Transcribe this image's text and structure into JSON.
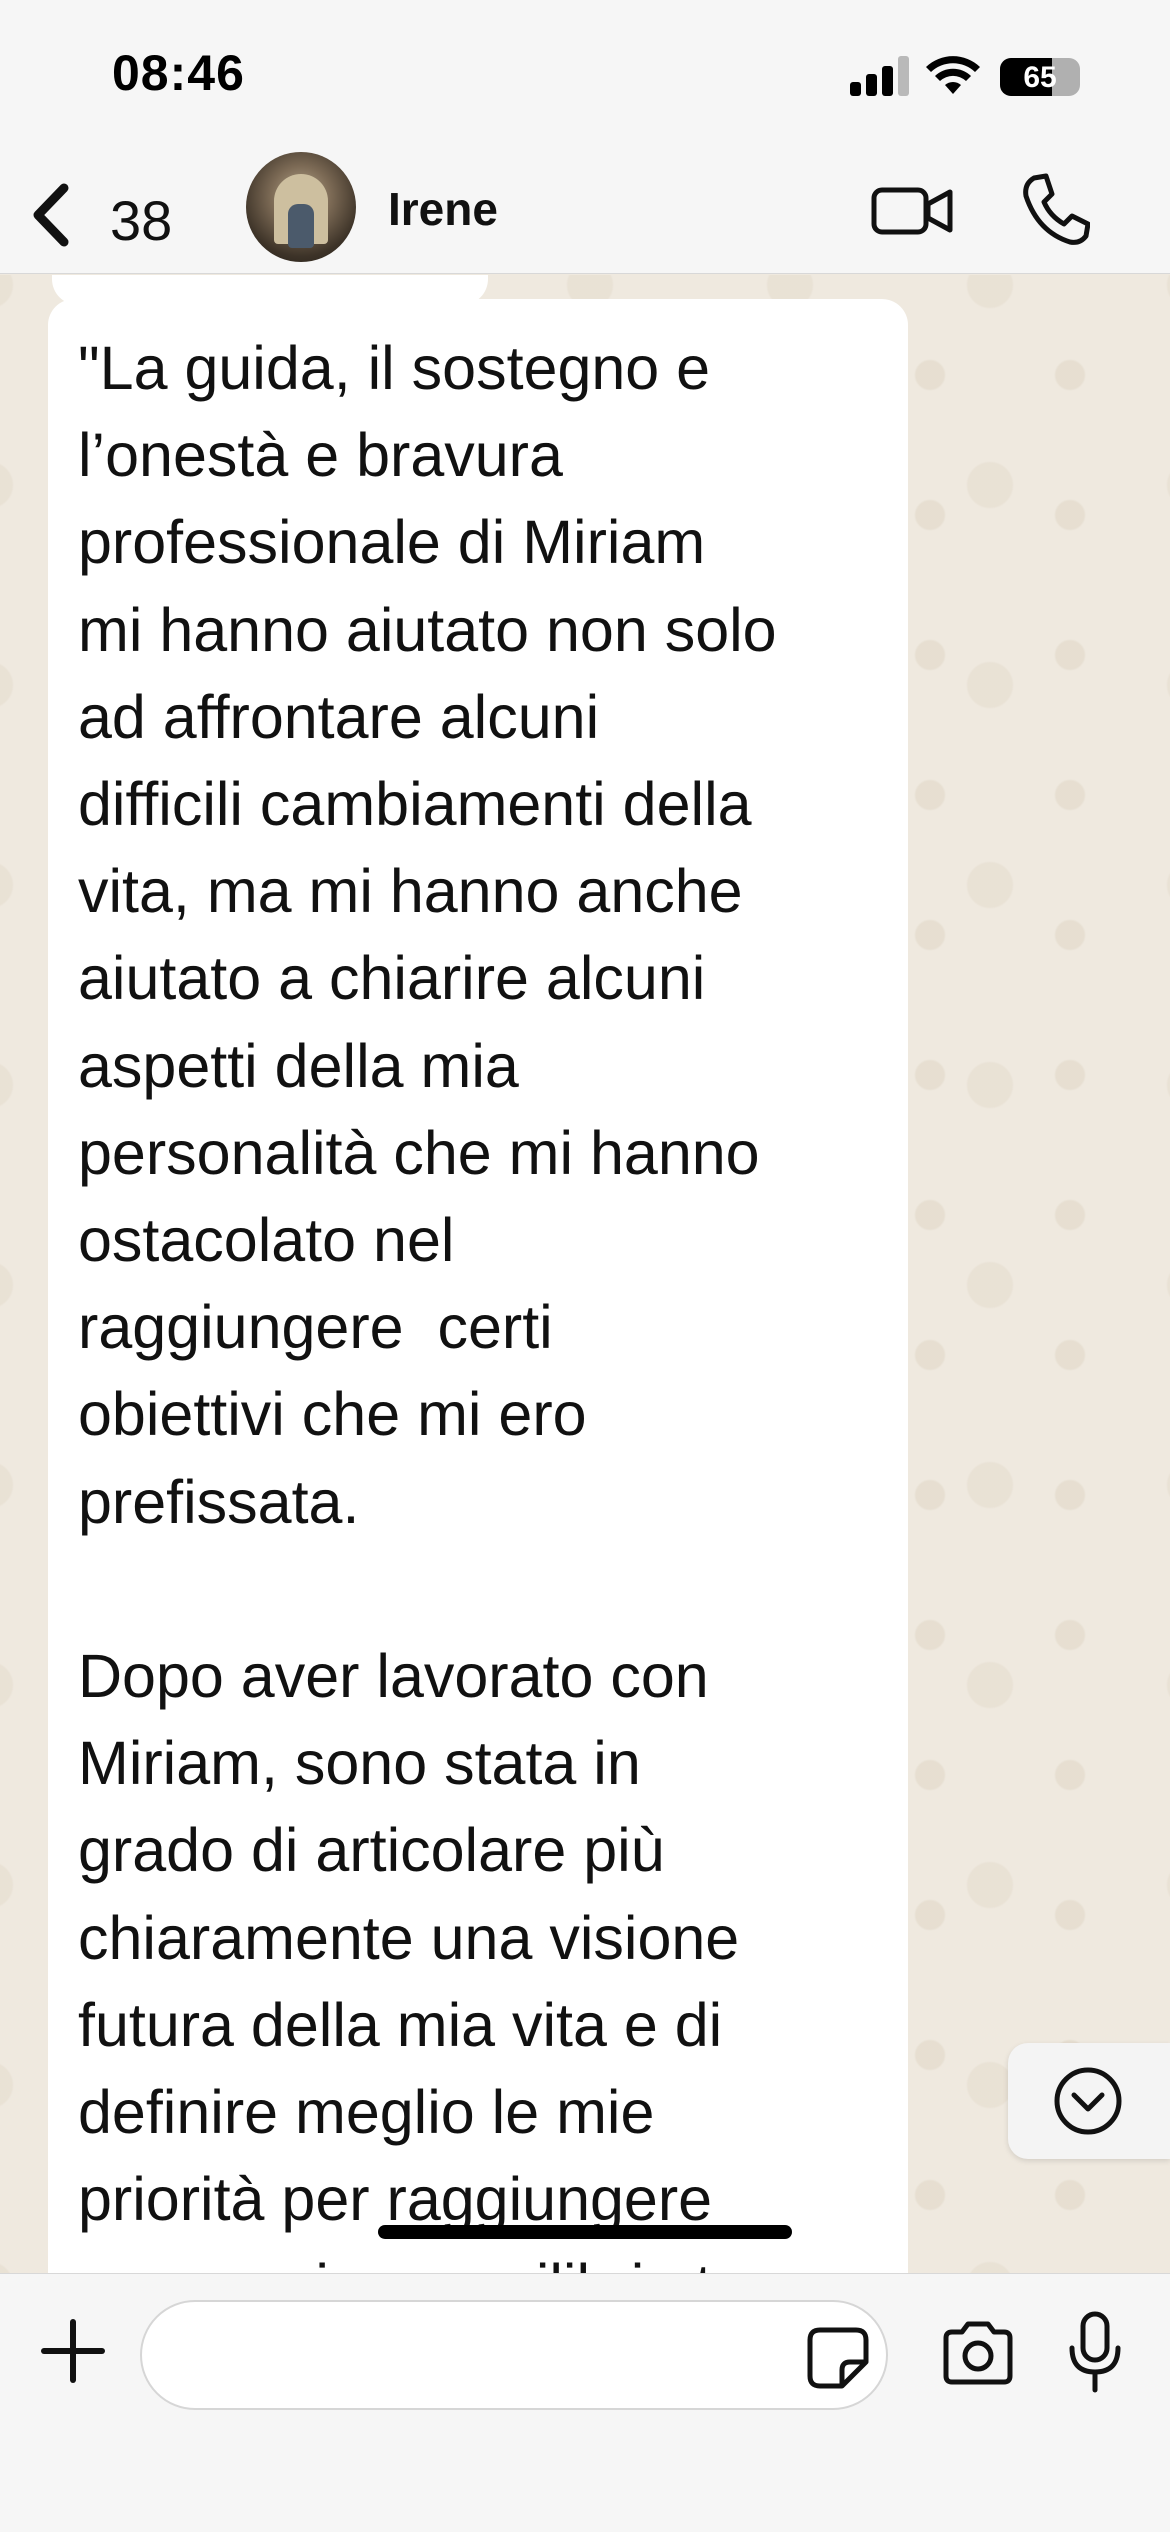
{
  "status_bar": {
    "time": "08:46",
    "battery_level": "65",
    "battery_percent": 65,
    "signal_bars": 3,
    "signal_bars_total": 4,
    "icons": [
      "cellular-signal-icon",
      "wifi-icon",
      "battery-icon"
    ]
  },
  "header": {
    "back_icon": "chevron-left-icon",
    "unread_count": "38",
    "contact_name": "Irene",
    "actions": [
      "video-camera-icon",
      "phone-icon"
    ]
  },
  "message": {
    "text": "\"La guida, il sostegno e\nl’onestà e bravura\nprofessionale di Miriam\nmi hanno aiutato non solo\nad affrontare alcuni\ndifficili cambiamenti della\nvita, ma mi hanno anche\naiutato a chiarire alcuni\naspetti della mia\npersonalità che mi hanno\nostacolato nel\nraggiungere  certi\nobiettivi che mi ero\nprefissata.\n\nDopo aver lavorato con\nMiriam, sono stata in\ngrado di articolare più\nchiaramente una visione\nfutura della mia vita e di\ndefinire meglio le mie\npriorità per raggiungere\nun maggiore equilibrio tra"
  },
  "scroll_button": {
    "icon": "chevron-down-circle-icon"
  },
  "input_bar": {
    "placeholder": "",
    "value": "",
    "icons": [
      "plus-icon",
      "sticker-icon",
      "camera-icon",
      "microphone-icon"
    ]
  },
  "colors": {
    "chat_background": "#efe9df",
    "bubble": "#ffffff",
    "bar_background": "#f6f6f6",
    "text": "#111111"
  }
}
